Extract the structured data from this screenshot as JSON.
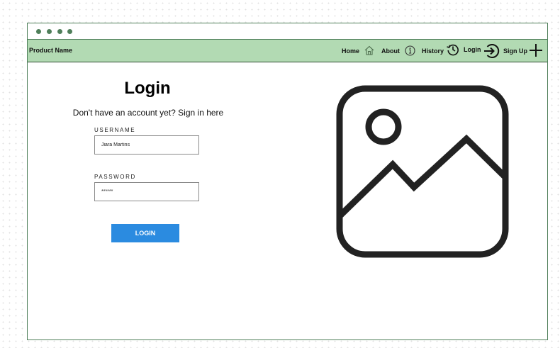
{
  "navbar": {
    "brand": "Product Name",
    "items": [
      {
        "label": "Home",
        "icon": "home-icon"
      },
      {
        "label": "About",
        "icon": "info-icon"
      },
      {
        "label": "History",
        "icon": "history-icon"
      },
      {
        "label": "Login",
        "icon": "login-icon"
      },
      {
        "label": "Sign Up",
        "icon": "plus-icon"
      }
    ]
  },
  "login": {
    "title": "Login",
    "signup_prompt": "Don't have an account yet? Sign in here",
    "username_label": "USERNAME",
    "username_value": "Jiara Martins",
    "password_label": "PASSWORD",
    "password_value": "******",
    "button_label": "LOGIN"
  },
  "colors": {
    "navbar_bg": "#b2dab3",
    "frame": "#4f7f5a",
    "button_bg": "#2b8be0"
  },
  "illustration_icon": "image-placeholder-icon"
}
